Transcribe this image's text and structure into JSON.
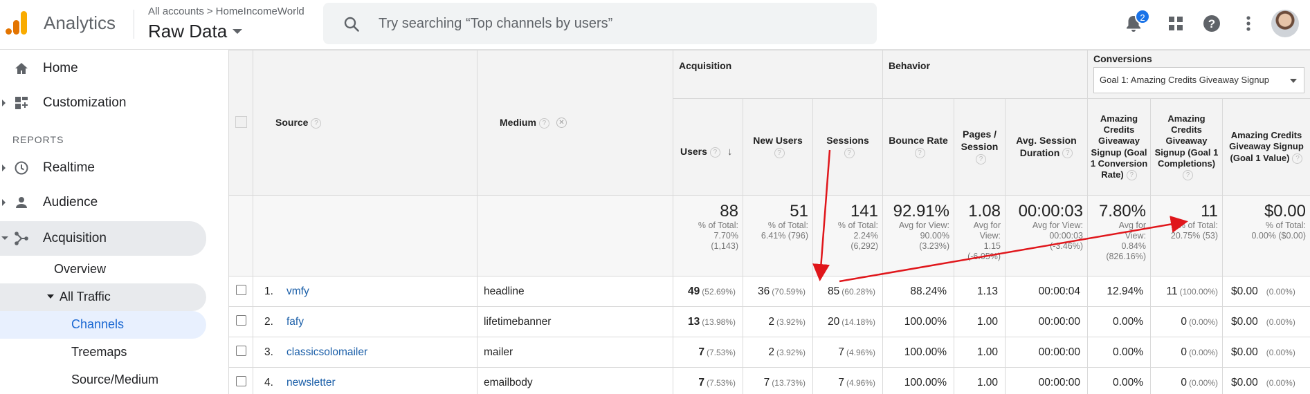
{
  "header": {
    "app_name": "Analytics",
    "breadcrumb": [
      "All accounts",
      "HomeIncomeWorld"
    ],
    "breadcrumb_sep": ">",
    "view_name": "Raw Data",
    "search_placeholder": "Try searching “Top channels by users”",
    "notification_count": "2",
    "icons": [
      "search-icon",
      "bell-icon",
      "apps-grid-icon",
      "help-icon",
      "more-vert-icon"
    ]
  },
  "sidebar": {
    "home": "Home",
    "customization": "Customization",
    "reports_label": "REPORTS",
    "realtime": "Realtime",
    "audience": "Audience",
    "acquisition": "Acquisition",
    "overview": "Overview",
    "all_traffic": "All Traffic",
    "channels": "Channels",
    "treemaps": "Treemaps",
    "source_medium": "Source/Medium"
  },
  "table": {
    "col_source": "Source",
    "col_medium": "Medium",
    "group_acquisition": "Acquisition",
    "group_behavior": "Behavior",
    "group_conversions": "Conversions",
    "goal_select": "Goal 1: Amazing Credits Giveaway Signup",
    "col_users": "Users",
    "col_new_users": "New Users",
    "col_sessions": "Sessions",
    "col_bounce": "Bounce Rate",
    "col_pages": "Pages / Session",
    "col_duration": "Avg. Session Duration",
    "col_conv_rate": "Amazing Credits Giveaway Signup (Goal 1 Conversion Rate)",
    "col_completions": "Amazing Credits Giveaway Signup (Goal 1 Completions)",
    "col_value": "Amazing Credits Giveaway Signup (Goal 1 Value)",
    "totals": {
      "users": {
        "main": "88",
        "sub1": "% of Total:",
        "sub2": "7.70%",
        "sub3": "(1,143)"
      },
      "new_users": {
        "main": "51",
        "sub1": "% of Total:",
        "sub2": "6.41% (796)"
      },
      "sessions": {
        "main": "141",
        "sub1": "% of Total:",
        "sub2": "2.24%",
        "sub3": "(6,292)"
      },
      "bounce": {
        "main": "92.91%",
        "sub1": "Avg for View:",
        "sub2": "90.00%",
        "sub3": "(3.23%)"
      },
      "pages": {
        "main": "1.08",
        "sub1": "Avg for",
        "sub2": "View:",
        "sub3": "1.15",
        "sub4": "(-6.05%)"
      },
      "duration": {
        "main": "00:00:03",
        "sub1": "Avg for View:",
        "sub2": "00:00:03",
        "sub3": "(-3.46%)"
      },
      "conv_rate": {
        "main": "7.80%",
        "sub1": "Avg for",
        "sub2": "View:",
        "sub3": "0.84%",
        "sub4": "(826.16%)"
      },
      "completions": {
        "main": "11",
        "sub1": "% of Total:",
        "sub2": "20.75% (53)"
      },
      "value": {
        "main": "$0.00",
        "sub1": "% of Total:",
        "sub2": "0.00% ($0.00)"
      }
    },
    "rows": [
      {
        "idx": "1.",
        "source": "vmfy",
        "medium": "headline",
        "users": "49",
        "users_pct": "(52.69%)",
        "new_users": "36",
        "new_users_pct": "(70.59%)",
        "sessions": "85",
        "sessions_pct": "(60.28%)",
        "bounce": "88.24%",
        "pages": "1.13",
        "duration": "00:00:04",
        "conv_rate": "12.94%",
        "completions": "11",
        "completions_pct": "(100.00%)",
        "value": "$0.00",
        "value_pct": "(0.00%)"
      },
      {
        "idx": "2.",
        "source": "fafy",
        "medium": "lifetimebanner",
        "users": "13",
        "users_pct": "(13.98%)",
        "new_users": "2",
        "new_users_pct": "(3.92%)",
        "sessions": "20",
        "sessions_pct": "(14.18%)",
        "bounce": "100.00%",
        "pages": "1.00",
        "duration": "00:00:00",
        "conv_rate": "0.00%",
        "completions": "0",
        "completions_pct": "(0.00%)",
        "value": "$0.00",
        "value_pct": "(0.00%)"
      },
      {
        "idx": "3.",
        "source": "classicsolomailer",
        "medium": "mailer",
        "users": "7",
        "users_pct": "(7.53%)",
        "new_users": "2",
        "new_users_pct": "(3.92%)",
        "sessions": "7",
        "sessions_pct": "(4.96%)",
        "bounce": "100.00%",
        "pages": "1.00",
        "duration": "00:00:00",
        "conv_rate": "0.00%",
        "completions": "0",
        "completions_pct": "(0.00%)",
        "value": "$0.00",
        "value_pct": "(0.00%)"
      },
      {
        "idx": "4.",
        "source": "newsletter",
        "medium": "emailbody",
        "users": "7",
        "users_pct": "(7.53%)",
        "new_users": "7",
        "new_users_pct": "(13.73%)",
        "sessions": "7",
        "sessions_pct": "(4.96%)",
        "bounce": "100.00%",
        "pages": "1.00",
        "duration": "00:00:00",
        "conv_rate": "0.00%",
        "completions": "0",
        "completions_pct": "(0.00%)",
        "value": "$0.00",
        "value_pct": "(0.00%)"
      }
    ]
  },
  "colors": {
    "accent_blue": "#1a73e8",
    "link_blue": "#1a5ea8",
    "annotation_red": "#e0161b",
    "logo_orange": "#f9ab00",
    "logo_dark_orange": "#e37400"
  }
}
